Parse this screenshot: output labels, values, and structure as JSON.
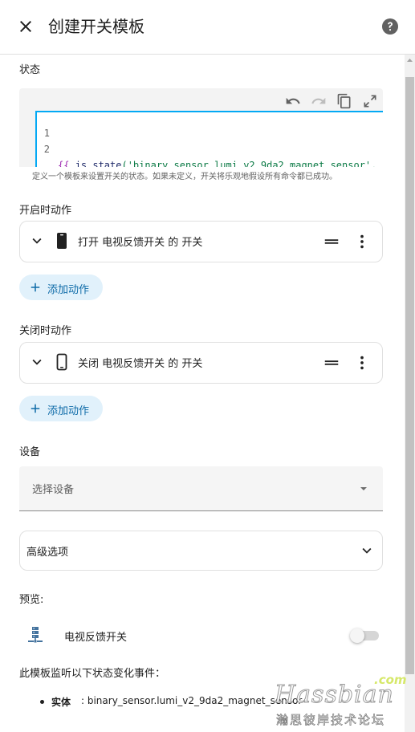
{
  "header": {
    "title": "创建开关模板"
  },
  "state_section": {
    "label": "状态",
    "code_lines": {
      "n1": "1",
      "n2": "2",
      "line1_open": "{{ ",
      "line1_fn": "is_state",
      "line1_args": "('binary_sensor.lumi_v2_9da2_magnet_sensor', '",
      "line2_kw": "true",
      "line2_rest": "') }}"
    },
    "helper": "定义一个模板来设置开关的状态。如果未定义，开关将乐观地假设所有命令都已成功。"
  },
  "on_section": {
    "label": "开启时动作",
    "action_label": "打开 电视反馈开关 的 开关",
    "add_label": "添加动作"
  },
  "off_section": {
    "label": "关闭时动作",
    "action_label": "关闭 电视反馈开关 的 开关",
    "add_label": "添加动作"
  },
  "device_section": {
    "label": "设备",
    "placeholder": "选择设备"
  },
  "advanced": {
    "label": "高级选项"
  },
  "preview": {
    "label": "预览:",
    "entity_name": "电视反馈开关",
    "toggle_on": false
  },
  "listen": {
    "label": "此模板监听以下状态变化事件：",
    "entity_key": "实体",
    "entity_value": ": binary_sensor.lumi_v2_9da2_magnet_sensor"
  },
  "watermark": {
    "com": ".com",
    "brand": "Hassbian",
    "cn": "瀚思彼岸技术论坛"
  },
  "colors": {
    "accent": "#03a9f4",
    "add_button_bg": "#e1f1fb",
    "add_button_text": "#0e6ba8"
  },
  "icons": {
    "close": "close-icon",
    "help": "help-circle-icon",
    "undo": "undo-icon",
    "redo": "redo-icon",
    "copy": "copy-icon",
    "fullscreen": "fullscreen-icon",
    "chevron": "chevron-down-icon",
    "device": "cellphone-icon",
    "drag": "drag-handle-icon",
    "more": "dots-vertical-icon",
    "plus": "plus-icon",
    "preview": "server-network-icon"
  }
}
